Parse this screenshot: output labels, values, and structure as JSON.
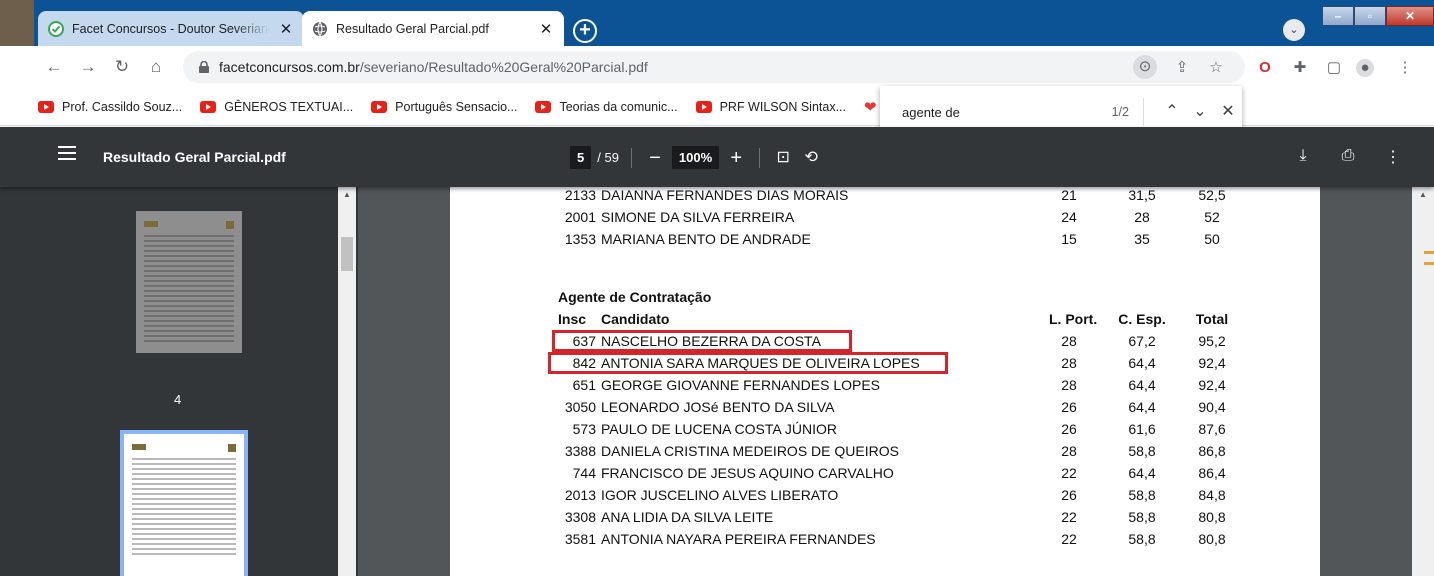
{
  "tabs": [
    {
      "title": "Facet Concursos - Doutor Severiano",
      "close": "✕"
    },
    {
      "title": "Resultado Geral Parcial.pdf",
      "close": "✕"
    }
  ],
  "toolbar": {
    "url_host": "facetconcursos.com.br",
    "url_path": "/severiano/Resultado%20Geral%20Parcial.pdf"
  },
  "bookmarks": [
    "Prof. Cassildo Souz...",
    "GÊNEROS TEXTUAI...",
    "Português Sensacio...",
    "Teorias da comunic...",
    "PRF WILSON Sintax..."
  ],
  "find": {
    "query": "agente de",
    "count": "1/2"
  },
  "pdf_toolbar": {
    "doc_title": "Resultado Geral Parcial.pdf",
    "page_current": "5",
    "page_total": "/ 59",
    "zoom": "100%"
  },
  "sidebar": {
    "page_label": "4"
  },
  "document": {
    "top_rows": [
      {
        "insc": "2133",
        "name": "DAIANNA FERNANDES DIAS MORAIS",
        "port": "21",
        "esp": "31,5",
        "total": "52,5"
      },
      {
        "insc": "2001",
        "name": "SIMONE DA SILVA FERREIRA",
        "port": "24",
        "esp": "28",
        "total": "52"
      },
      {
        "insc": "1353",
        "name": "MARIANA BENTO DE ANDRADE",
        "port": "15",
        "esp": "35",
        "total": "50"
      }
    ],
    "section_title": "Agente de Contratação",
    "headers": {
      "insc": "Insc",
      "name": "Candidato",
      "port": "L. Port.",
      "esp": "C. Esp.",
      "total": "Total"
    },
    "rows": [
      {
        "insc": "637",
        "name": "NASCELHO BEZERRA DA COSTA",
        "port": "28",
        "esp": "67,2",
        "total": "95,2"
      },
      {
        "insc": "842",
        "name": "ANTONIA SARA MARQUES DE OLIVEIRA LOPES",
        "port": "28",
        "esp": "64,4",
        "total": "92,4"
      },
      {
        "insc": "651",
        "name": "GEORGE GIOVANNE FERNANDES LOPES",
        "port": "28",
        "esp": "64,4",
        "total": "92,4"
      },
      {
        "insc": "3050",
        "name": "LEONARDO JOSé BENTO DA SILVA",
        "port": "26",
        "esp": "64,4",
        "total": "90,4"
      },
      {
        "insc": "573",
        "name": "PAULO DE LUCENA COSTA JÚNIOR",
        "port": "26",
        "esp": "61,6",
        "total": "87,6"
      },
      {
        "insc": "3388",
        "name": "DANIELA CRISTINA MEDEIROS DE QUEIROS",
        "port": "28",
        "esp": "58,8",
        "total": "86,8"
      },
      {
        "insc": "744",
        "name": "FRANCISCO DE JESUS AQUINO CARVALHO",
        "port": "22",
        "esp": "64,4",
        "total": "86,4"
      },
      {
        "insc": "2013",
        "name": "IGOR JUSCELINO ALVES LIBERATO",
        "port": "26",
        "esp": "58,8",
        "total": "84,8"
      },
      {
        "insc": "3308",
        "name": "ANA LIDIA DA SILVA LEITE",
        "port": "22",
        "esp": "58,8",
        "total": "80,8"
      },
      {
        "insc": "3581",
        "name": "ANTONIA NAYARA PEREIRA FERNANDES",
        "port": "22",
        "esp": "58,8",
        "total": "80,8"
      }
    ]
  },
  "colors": {
    "tabstrip": "#0b5394",
    "pdf_toolbar": "#323639",
    "viewer_bg": "#525659",
    "highlight": "#d7242a"
  }
}
